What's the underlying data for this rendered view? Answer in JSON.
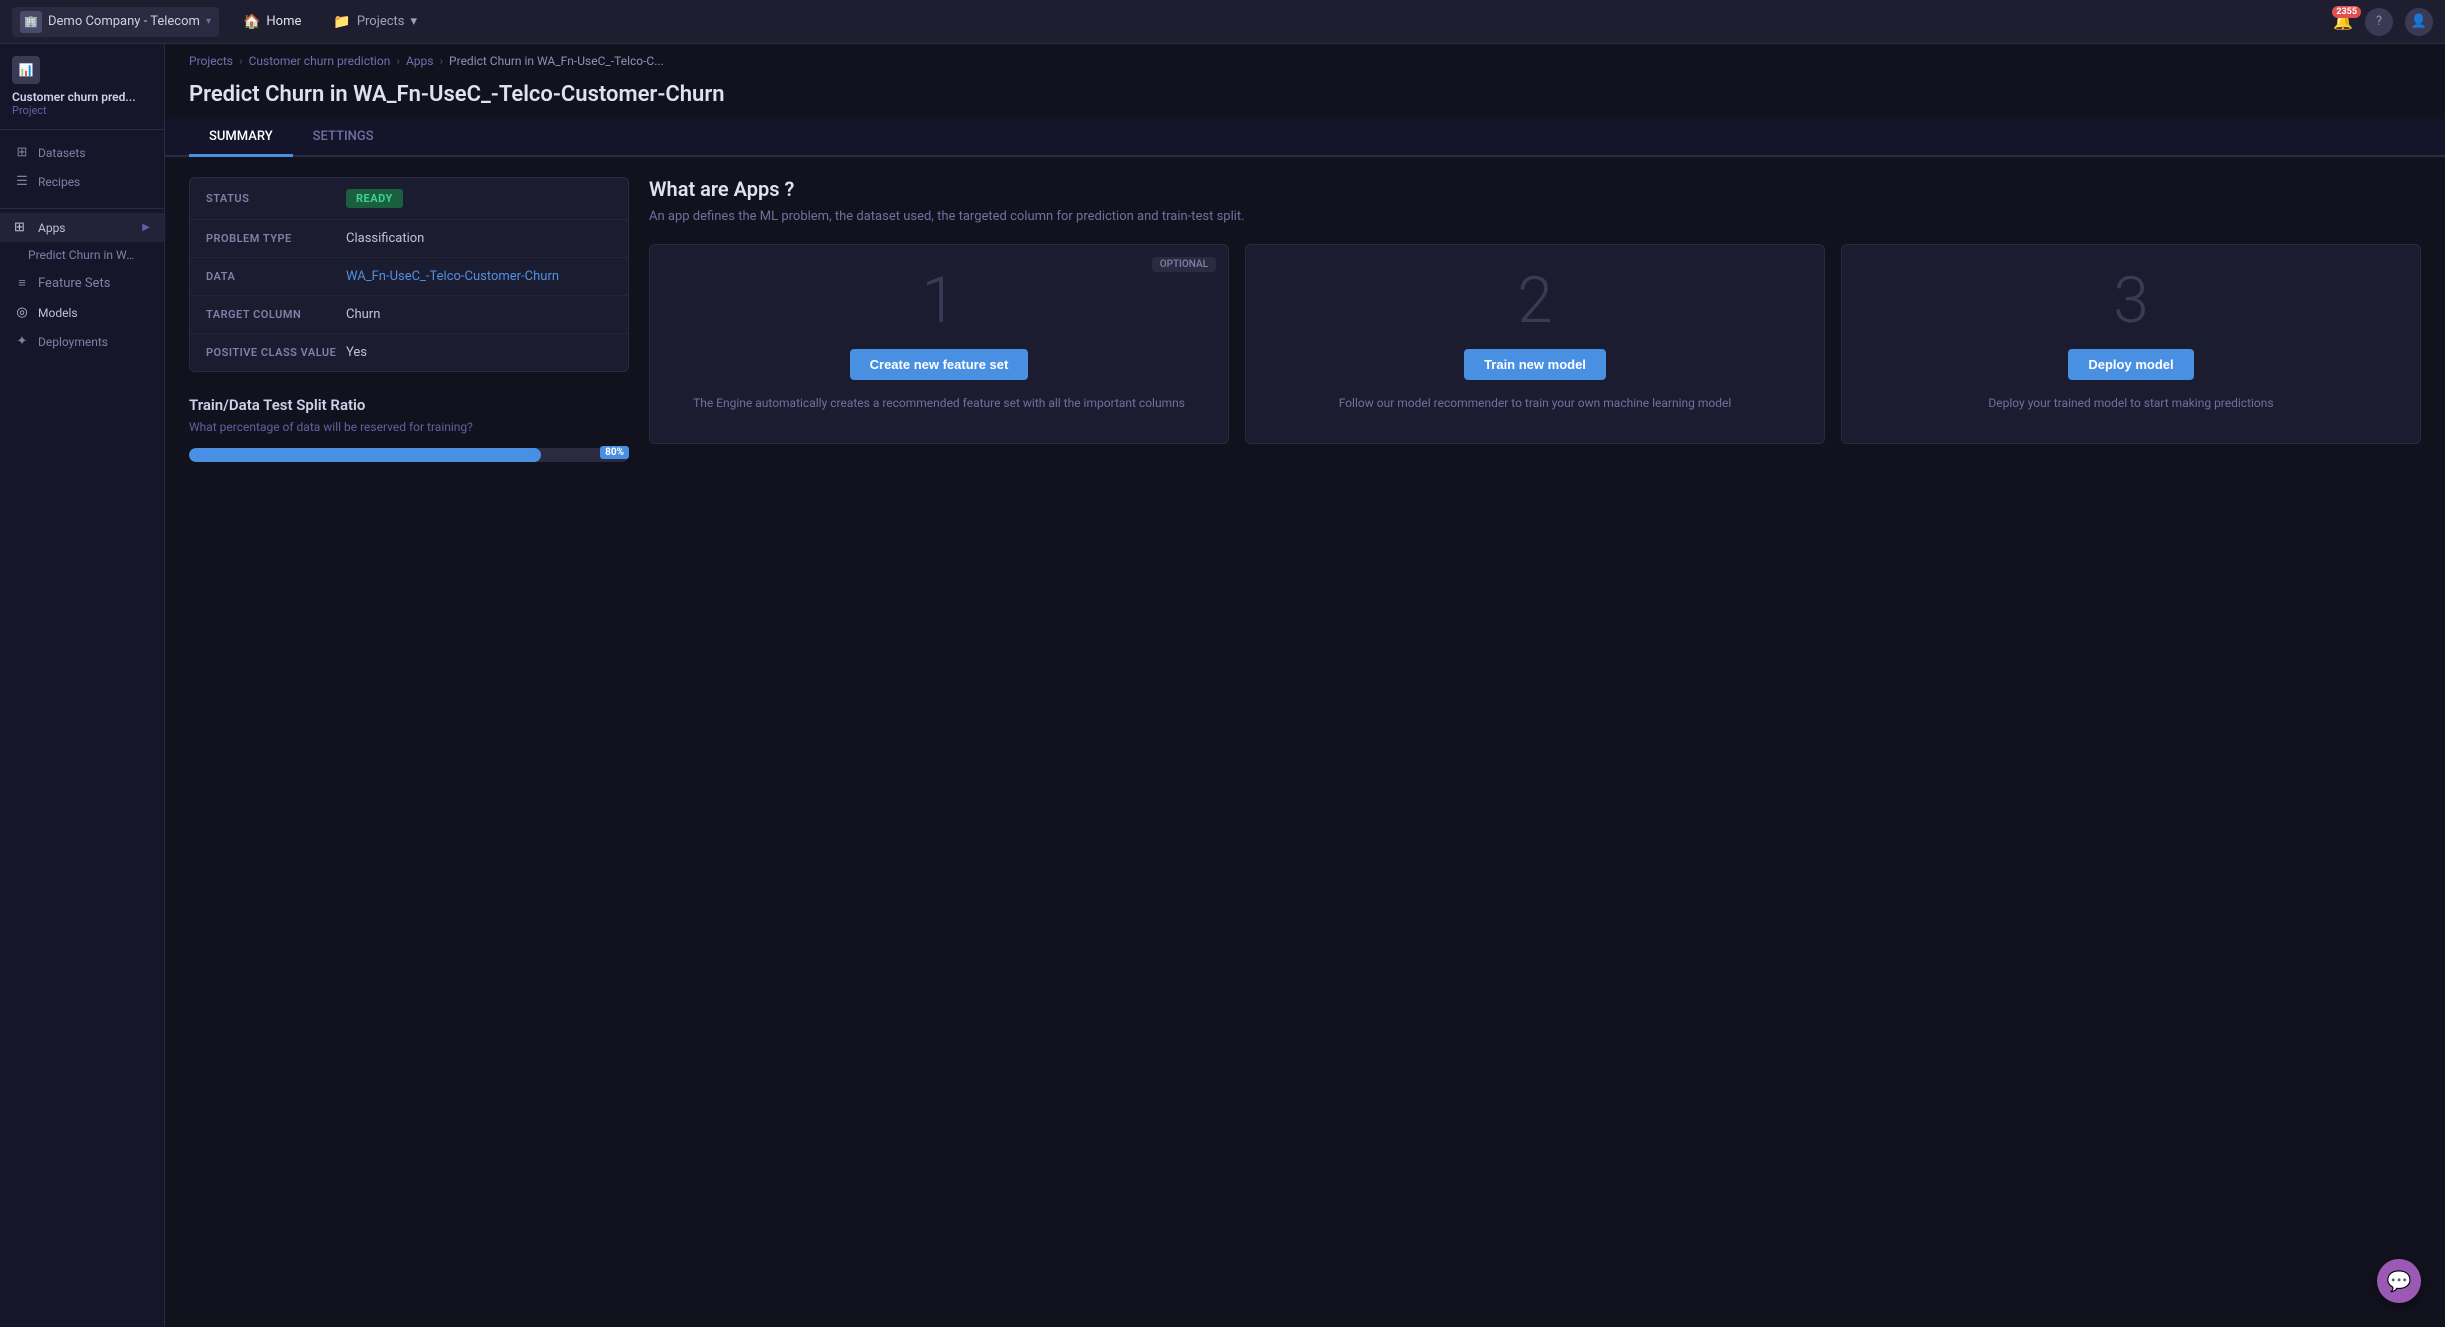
{
  "company": {
    "name": "Demo Company - Telecom",
    "icon": "🏢"
  },
  "topnav": {
    "home_label": "Home",
    "projects_label": "Projects",
    "notification_badge": "2355"
  },
  "breadcrumb": {
    "projects": "Projects",
    "customer_churn": "Customer churn prediction",
    "apps": "Apps",
    "current": "Predict Churn in WA_Fn-UseC_-Telco-C..."
  },
  "page": {
    "title": "Predict Churn in WA_Fn-UseC_-Telco-Customer-Churn"
  },
  "tabs": [
    {
      "id": "summary",
      "label": "SUMMARY",
      "active": true
    },
    {
      "id": "settings",
      "label": "SETTINGS",
      "active": false
    }
  ],
  "sidebar": {
    "project_name": "Customer churn pred...",
    "project_type": "Project",
    "items": [
      {
        "id": "datasets",
        "label": "Datasets",
        "icon": "⊞"
      },
      {
        "id": "recipes",
        "label": "Recipes",
        "icon": "☰"
      }
    ],
    "apps_section": {
      "label": "Apps",
      "icon": "⊞",
      "sub_item": "Predict Churn in WA_Fn-UseC..."
    },
    "app_menu": [
      {
        "id": "feature-sets",
        "label": "Feature Sets",
        "icon": "≡"
      },
      {
        "id": "models",
        "label": "Models",
        "icon": "◎",
        "active": true
      },
      {
        "id": "deployments",
        "label": "Deployments",
        "icon": "✦"
      }
    ]
  },
  "summary": {
    "status_label": "STATUS",
    "status_value": "READY",
    "problem_type_label": "PROBLEM TYPE",
    "problem_type_value": "Classification",
    "data_label": "DATA",
    "data_value": "WA_Fn-UseC_-Telco-Customer-Churn",
    "target_label": "TARGET COLUMN",
    "target_value": "Churn",
    "positive_label": "POSITIVE CLASS VALUE",
    "positive_value": "Yes"
  },
  "split": {
    "title": "Train/Data Test Split Ratio",
    "subtitle": "What percentage of data will be reserved for training?",
    "percent": "80%",
    "fill_width": "80%"
  },
  "apps_info": {
    "title": "What are Apps ?",
    "subtitle": "An app defines the ML problem, the dataset used, the targeted column for prediction and train-test split.",
    "cards": [
      {
        "id": "feature-set",
        "number": "1",
        "button_label": "Create new feature set",
        "description": "The Engine automatically creates a recommended feature set with all the important columns",
        "optional": true,
        "optional_label": "OPTIONAL"
      },
      {
        "id": "train-model",
        "number": "2",
        "button_label": "Train new model",
        "description": "Follow our model recommender to train your own machine learning model",
        "optional": false
      },
      {
        "id": "deploy-model",
        "number": "3",
        "button_label": "Deploy model",
        "description": "Deploy your trained model to start making predictions",
        "optional": false
      }
    ]
  },
  "chat": {
    "icon": "💬"
  }
}
